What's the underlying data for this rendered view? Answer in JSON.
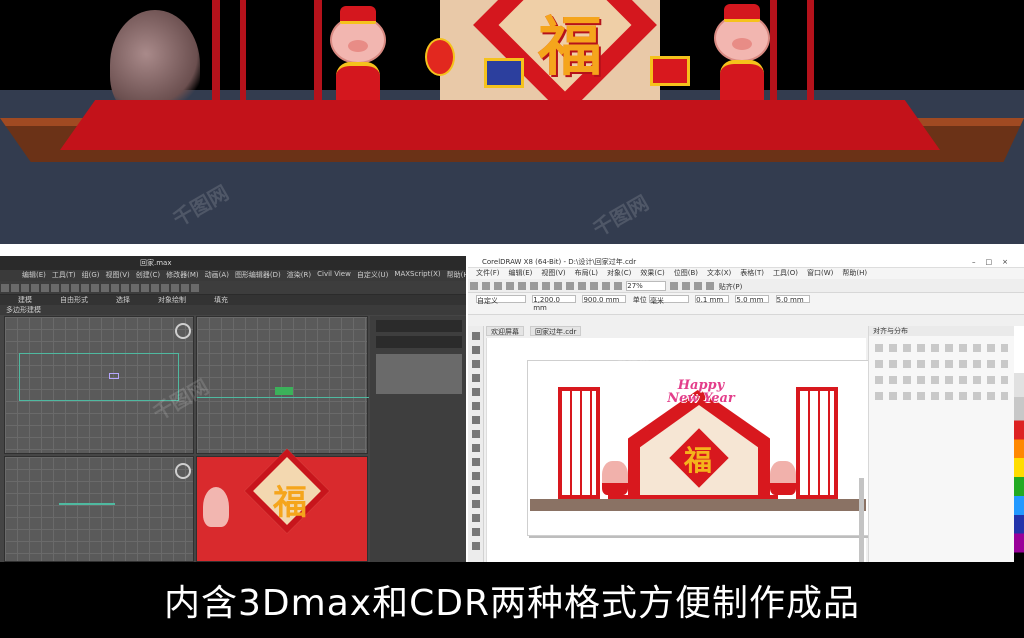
{
  "scene": {
    "fu_char": "福"
  },
  "watermark_text": "千图网",
  "max_window": {
    "title": "回家.max",
    "menu": [
      "编辑(E)",
      "工具(T)",
      "组(G)",
      "视图(V)",
      "创建(C)",
      "修改器(M)",
      "动画(A)",
      "图形编辑器(D)",
      "渲染(R)",
      "Civil View",
      "自定义(U)",
      "MAXScript(X)",
      "帮助(H)"
    ],
    "ribbon": [
      "建模",
      "自由形式",
      "选择",
      "对象绘制",
      "填充"
    ],
    "subribbon": "多边形建模",
    "render_fu": "福"
  },
  "cdr_window": {
    "title": "CorelDRAW X8 (64-Bit) - D:\\设计\\回家过年.cdr",
    "menu": [
      "文件(F)",
      "编辑(E)",
      "视图(V)",
      "布局(L)",
      "对象(C)",
      "效果(C)",
      "位图(B)",
      "文本(X)",
      "表格(T)",
      "工具(O)",
      "窗口(W)",
      "帮助(H)"
    ],
    "zoom": "27%",
    "preset": "自定义",
    "width_val": "1,200.0 mm",
    "height_val": "900.0 mm",
    "unit_label": "单位",
    "unit_val": "毫米",
    "nudge": "0.1 mm",
    "dup_x": "5.0 mm",
    "dup_y": "5.0 mm",
    "snap_label": "贴齐(P)",
    "tabs": [
      "欢迎屏幕",
      "回家过年.cdr"
    ],
    "docker_title": "对齐与分布",
    "design": {
      "fu": "福",
      "line1": "Happy",
      "line2": "New Year"
    }
  },
  "caption": "内含3Dmax和CDR两种格式方便制作成品"
}
